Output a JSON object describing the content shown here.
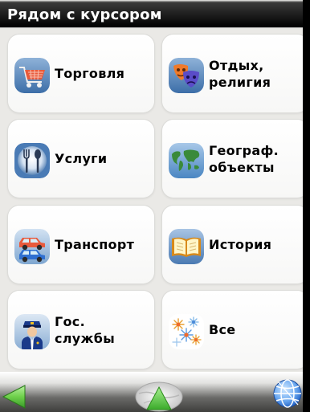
{
  "header": {
    "title": "Рядом с курсором"
  },
  "categories": [
    {
      "label": "Торговля",
      "icon": "shopping-cart-icon"
    },
    {
      "label": "Отдых,\nрелигия",
      "icon": "theater-masks-icon"
    },
    {
      "label": "Услуги",
      "icon": "fork-spoon-icon"
    },
    {
      "label": "Географ.\nобъекты",
      "icon": "world-map-icon"
    },
    {
      "label": "Транспорт",
      "icon": "cars-icon"
    },
    {
      "label": "История",
      "icon": "open-book-icon"
    },
    {
      "label": "Гос.\nслужбы",
      "icon": "officer-icon"
    },
    {
      "label": "Все",
      "icon": "sparkles-icon"
    }
  ],
  "toolbar": {
    "back_icon": "back-arrow-icon",
    "center_icon": "map-up-arrow-icon",
    "globe_icon": "globe-icon"
  },
  "colors": {
    "background": "#eae9e6",
    "tile": "#ffffff",
    "title_bar": "#000000",
    "accent_green": "#6ed04a",
    "globe_blue": "#2a6fd6"
  }
}
